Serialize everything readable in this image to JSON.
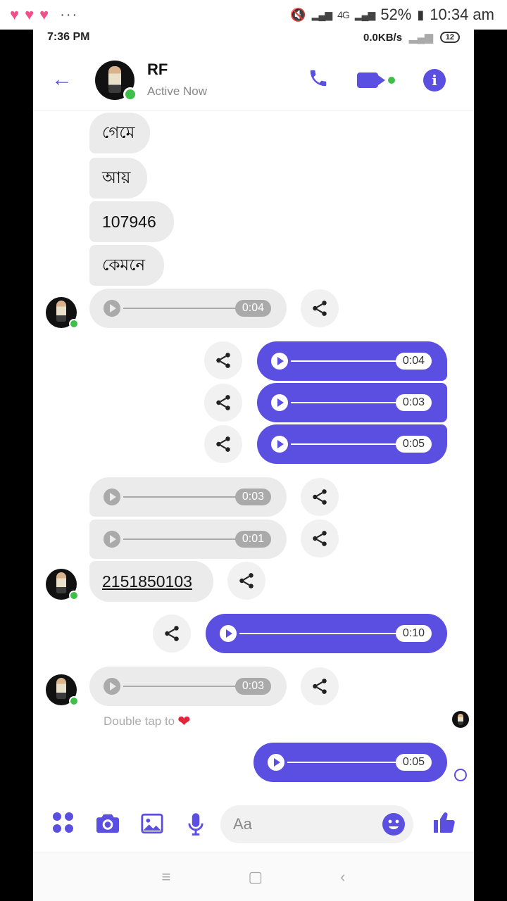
{
  "outer_status": {
    "more": "···",
    "battery": "52%",
    "time": "10:34 am",
    "network": "4G"
  },
  "inner_status": {
    "time": "7:36 PM",
    "speed": "0.0KB/s",
    "battery": "12"
  },
  "header": {
    "name": "RF",
    "status": "Active Now"
  },
  "messages": {
    "m1": "গেমে",
    "m2": "আয়",
    "m3": "107946",
    "m4": "কেমনে",
    "a1": "0:04",
    "a2": "0:04",
    "a3": "0:03",
    "a4": "0:05",
    "a5": "0:03",
    "a6": "0:01",
    "link": "2151850103",
    "a7": "0:10",
    "a8": "0:03",
    "a9": "0:05",
    "double_tap": "Double tap to"
  },
  "composer": {
    "placeholder": "Aa"
  },
  "colors": {
    "accent": "#5a4fe0",
    "online": "#3fbf4a"
  }
}
